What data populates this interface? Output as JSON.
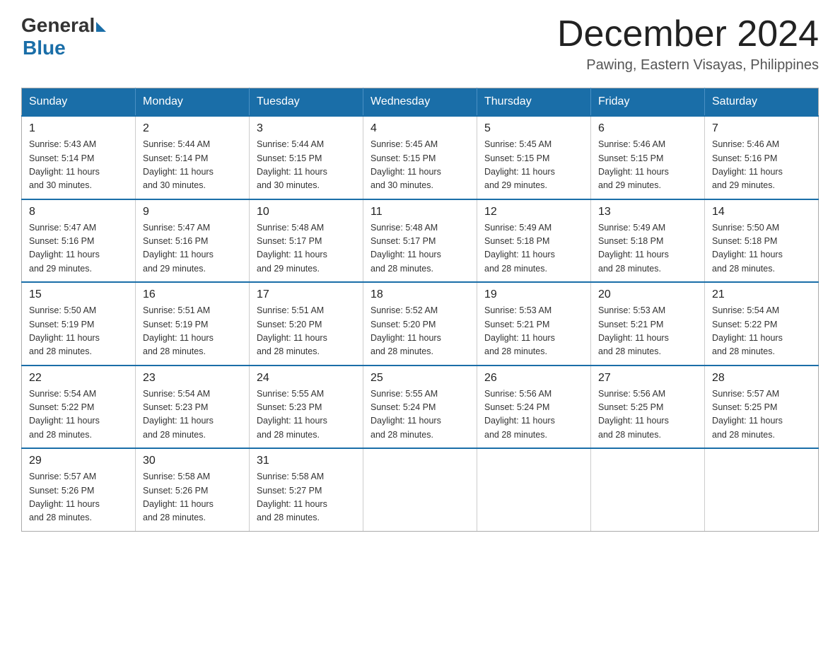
{
  "logo": {
    "general": "General",
    "blue": "Blue"
  },
  "title": "December 2024",
  "location": "Pawing, Eastern Visayas, Philippines",
  "weekdays": [
    "Sunday",
    "Monday",
    "Tuesday",
    "Wednesday",
    "Thursday",
    "Friday",
    "Saturday"
  ],
  "weeks": [
    [
      {
        "day": "1",
        "info": "Sunrise: 5:43 AM\nSunset: 5:14 PM\nDaylight: 11 hours\nand 30 minutes."
      },
      {
        "day": "2",
        "info": "Sunrise: 5:44 AM\nSunset: 5:14 PM\nDaylight: 11 hours\nand 30 minutes."
      },
      {
        "day": "3",
        "info": "Sunrise: 5:44 AM\nSunset: 5:15 PM\nDaylight: 11 hours\nand 30 minutes."
      },
      {
        "day": "4",
        "info": "Sunrise: 5:45 AM\nSunset: 5:15 PM\nDaylight: 11 hours\nand 30 minutes."
      },
      {
        "day": "5",
        "info": "Sunrise: 5:45 AM\nSunset: 5:15 PM\nDaylight: 11 hours\nand 29 minutes."
      },
      {
        "day": "6",
        "info": "Sunrise: 5:46 AM\nSunset: 5:15 PM\nDaylight: 11 hours\nand 29 minutes."
      },
      {
        "day": "7",
        "info": "Sunrise: 5:46 AM\nSunset: 5:16 PM\nDaylight: 11 hours\nand 29 minutes."
      }
    ],
    [
      {
        "day": "8",
        "info": "Sunrise: 5:47 AM\nSunset: 5:16 PM\nDaylight: 11 hours\nand 29 minutes."
      },
      {
        "day": "9",
        "info": "Sunrise: 5:47 AM\nSunset: 5:16 PM\nDaylight: 11 hours\nand 29 minutes."
      },
      {
        "day": "10",
        "info": "Sunrise: 5:48 AM\nSunset: 5:17 PM\nDaylight: 11 hours\nand 29 minutes."
      },
      {
        "day": "11",
        "info": "Sunrise: 5:48 AM\nSunset: 5:17 PM\nDaylight: 11 hours\nand 28 minutes."
      },
      {
        "day": "12",
        "info": "Sunrise: 5:49 AM\nSunset: 5:18 PM\nDaylight: 11 hours\nand 28 minutes."
      },
      {
        "day": "13",
        "info": "Sunrise: 5:49 AM\nSunset: 5:18 PM\nDaylight: 11 hours\nand 28 minutes."
      },
      {
        "day": "14",
        "info": "Sunrise: 5:50 AM\nSunset: 5:18 PM\nDaylight: 11 hours\nand 28 minutes."
      }
    ],
    [
      {
        "day": "15",
        "info": "Sunrise: 5:50 AM\nSunset: 5:19 PM\nDaylight: 11 hours\nand 28 minutes."
      },
      {
        "day": "16",
        "info": "Sunrise: 5:51 AM\nSunset: 5:19 PM\nDaylight: 11 hours\nand 28 minutes."
      },
      {
        "day": "17",
        "info": "Sunrise: 5:51 AM\nSunset: 5:20 PM\nDaylight: 11 hours\nand 28 minutes."
      },
      {
        "day": "18",
        "info": "Sunrise: 5:52 AM\nSunset: 5:20 PM\nDaylight: 11 hours\nand 28 minutes."
      },
      {
        "day": "19",
        "info": "Sunrise: 5:53 AM\nSunset: 5:21 PM\nDaylight: 11 hours\nand 28 minutes."
      },
      {
        "day": "20",
        "info": "Sunrise: 5:53 AM\nSunset: 5:21 PM\nDaylight: 11 hours\nand 28 minutes."
      },
      {
        "day": "21",
        "info": "Sunrise: 5:54 AM\nSunset: 5:22 PM\nDaylight: 11 hours\nand 28 minutes."
      }
    ],
    [
      {
        "day": "22",
        "info": "Sunrise: 5:54 AM\nSunset: 5:22 PM\nDaylight: 11 hours\nand 28 minutes."
      },
      {
        "day": "23",
        "info": "Sunrise: 5:54 AM\nSunset: 5:23 PM\nDaylight: 11 hours\nand 28 minutes."
      },
      {
        "day": "24",
        "info": "Sunrise: 5:55 AM\nSunset: 5:23 PM\nDaylight: 11 hours\nand 28 minutes."
      },
      {
        "day": "25",
        "info": "Sunrise: 5:55 AM\nSunset: 5:24 PM\nDaylight: 11 hours\nand 28 minutes."
      },
      {
        "day": "26",
        "info": "Sunrise: 5:56 AM\nSunset: 5:24 PM\nDaylight: 11 hours\nand 28 minutes."
      },
      {
        "day": "27",
        "info": "Sunrise: 5:56 AM\nSunset: 5:25 PM\nDaylight: 11 hours\nand 28 minutes."
      },
      {
        "day": "28",
        "info": "Sunrise: 5:57 AM\nSunset: 5:25 PM\nDaylight: 11 hours\nand 28 minutes."
      }
    ],
    [
      {
        "day": "29",
        "info": "Sunrise: 5:57 AM\nSunset: 5:26 PM\nDaylight: 11 hours\nand 28 minutes."
      },
      {
        "day": "30",
        "info": "Sunrise: 5:58 AM\nSunset: 5:26 PM\nDaylight: 11 hours\nand 28 minutes."
      },
      {
        "day": "31",
        "info": "Sunrise: 5:58 AM\nSunset: 5:27 PM\nDaylight: 11 hours\nand 28 minutes."
      },
      {
        "day": "",
        "info": ""
      },
      {
        "day": "",
        "info": ""
      },
      {
        "day": "",
        "info": ""
      },
      {
        "day": "",
        "info": ""
      }
    ]
  ]
}
